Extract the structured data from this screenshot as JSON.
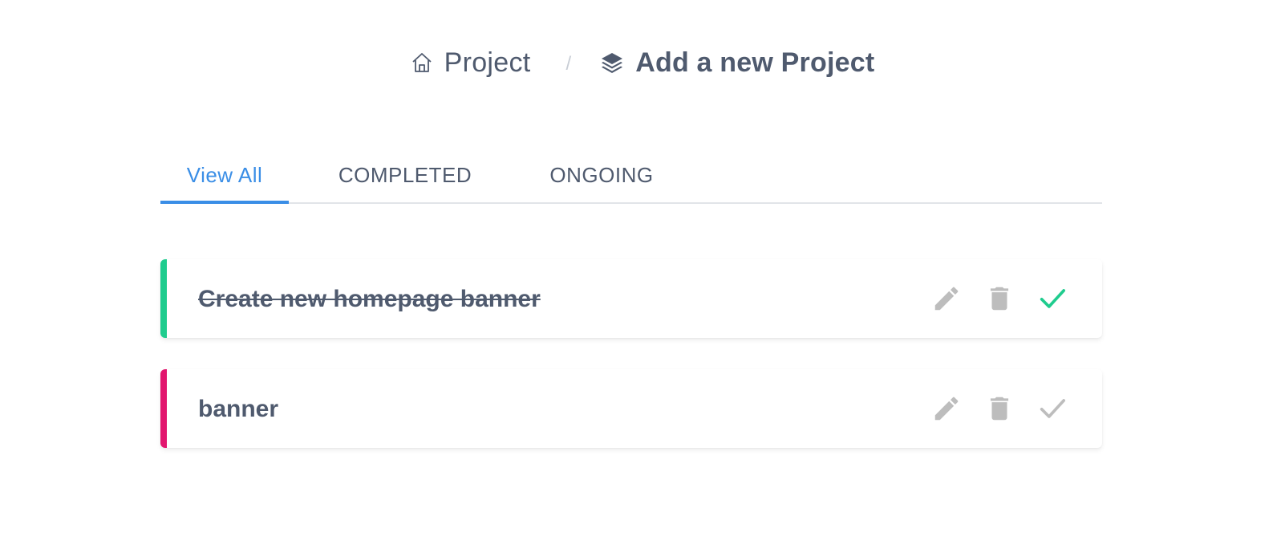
{
  "breadcrumb": {
    "home_label": "Project",
    "home_icon": "home-icon",
    "separator": "/",
    "current_label": "Add a new Project",
    "current_icon": "layers-icon"
  },
  "tabs": [
    {
      "label": "View All",
      "active": true
    },
    {
      "label": "COMPLETED",
      "active": false
    },
    {
      "label": "ONGOING",
      "active": false
    }
  ],
  "projects": [
    {
      "title": "Create new homepage banner",
      "completed": true,
      "accent_color": "#1fcc8e",
      "actions": [
        "pencil-icon",
        "trash-icon",
        "check-icon"
      ],
      "check_color": "#1fcc8e"
    },
    {
      "title": "banner",
      "completed": false,
      "accent_color": "#e2166e",
      "actions": [
        "pencil-icon",
        "trash-icon",
        "check-icon"
      ],
      "check_color": "#bdbdbd"
    }
  ],
  "colors": {
    "text": "#4f5a6e",
    "active_tab": "#3a8ee6",
    "icon_gray": "#bdbdbd"
  }
}
